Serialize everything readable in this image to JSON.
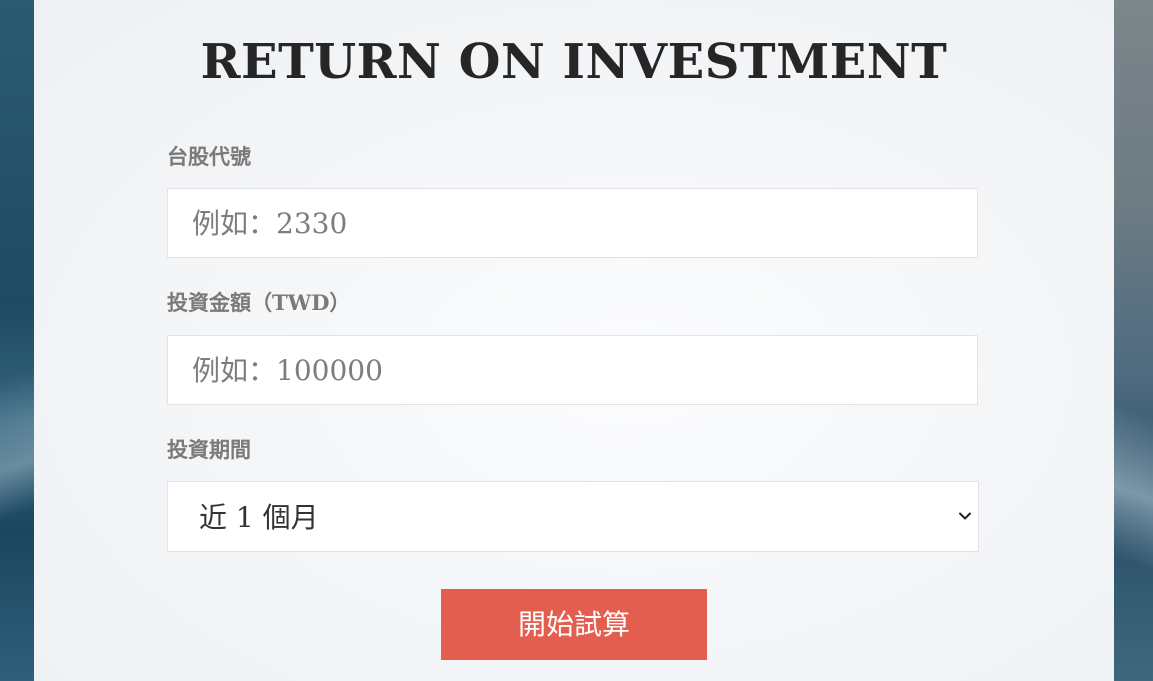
{
  "page": {
    "title": "RETURN ON INVESTMENT"
  },
  "form": {
    "stock_code": {
      "label": "台股代號",
      "placeholder": "例如：2330"
    },
    "amount": {
      "label": "投資金額（TWD）",
      "placeholder": "例如：100000"
    },
    "period": {
      "label": "投資期間",
      "selected": "近 1 個月"
    },
    "submit_label": "開始試算"
  },
  "colors": {
    "button_bg": "#e45e50",
    "card_bg": "#f3f5f7",
    "label_text": "#7a7a7a",
    "title_text": "#262626"
  }
}
